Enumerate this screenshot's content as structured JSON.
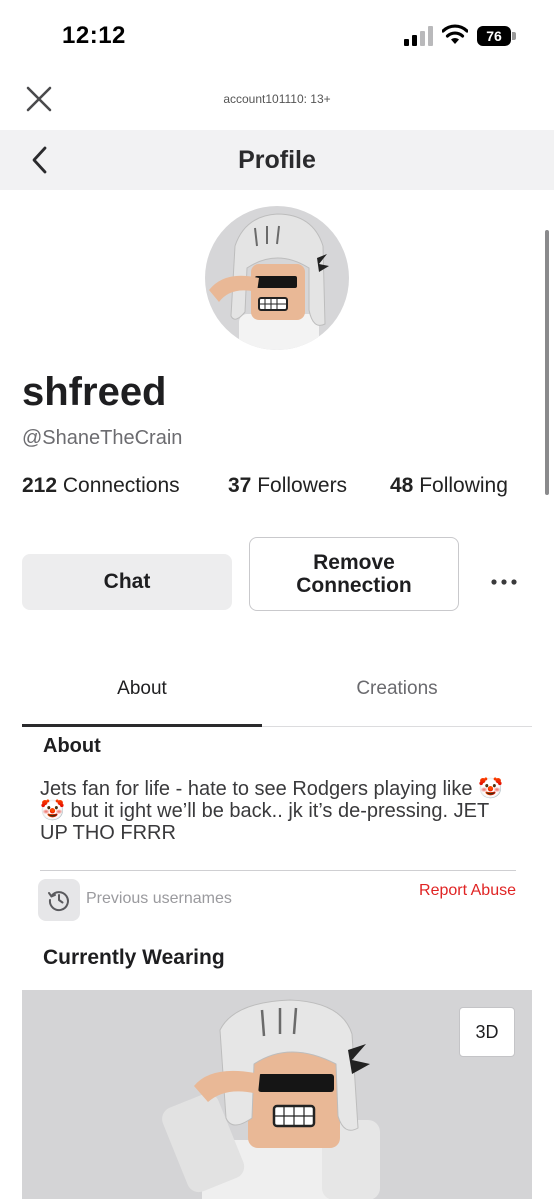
{
  "status_bar": {
    "time": "12:12",
    "battery": "76",
    "icons": [
      "signal-icon",
      "wifi-icon",
      "battery-icon"
    ]
  },
  "account": {
    "label": "account101110: 13+"
  },
  "header": {
    "title": "Profile"
  },
  "profile": {
    "display_name": "shfreed",
    "username": "@ShaneTheCrain",
    "stats": [
      {
        "count": "212",
        "label": "Connections"
      },
      {
        "count": "37",
        "label": "Followers"
      },
      {
        "count": "48",
        "label": "Following"
      }
    ]
  },
  "actions": {
    "chat": "Chat",
    "remove_connection": "Remove Connection"
  },
  "tabs": [
    {
      "label": "About",
      "active": true
    },
    {
      "label": "Creations",
      "active": false
    }
  ],
  "about": {
    "heading": "About",
    "text": "Jets fan for life - hate to see Rodgers playing like 🤡🤡 but it ight we’ll be back.. jk it’s de-pressing. JET UP THO FRRR",
    "previous_usernames": "Previous usernames",
    "report_abuse": "Report Abuse"
  },
  "wearing": {
    "heading": "Currently Wearing",
    "view_3d": "3D"
  },
  "colors": {
    "header_bg": "#f2f2f3",
    "report_red": "#e02424",
    "panel_bg": "#d4d4d6"
  }
}
